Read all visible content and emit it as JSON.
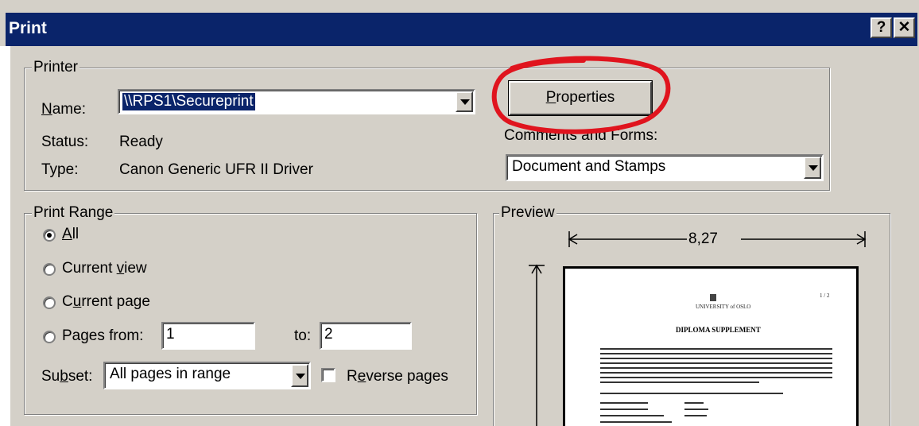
{
  "window": {
    "title": "Print",
    "help_label": "?",
    "close_label": "✕"
  },
  "printer": {
    "group_label": "Printer",
    "name_label_u": "N",
    "name_label_rest": "ame:",
    "name_value": "\\\\RPS1\\Secureprint",
    "status_label": "Status:",
    "status_value": "Ready",
    "type_label": "Type:",
    "type_value": "Canon Generic UFR II Driver",
    "properties_label_u": "P",
    "properties_label_rest": "roperties",
    "comments_label": "Comments and Forms:",
    "comments_value": "Document and Stamps"
  },
  "print_range": {
    "group_label": "Print Range",
    "options": [
      {
        "pre": "",
        "u": "A",
        "post": "ll",
        "checked": true
      },
      {
        "pre": "Current ",
        "u": "v",
        "post": "iew",
        "checked": false
      },
      {
        "pre": "C",
        "u": "u",
        "post": "rrent page",
        "checked": false
      },
      {
        "pre": "Pages from:",
        "u": "",
        "post": "",
        "checked": false
      }
    ],
    "from_value": "1",
    "to_label": "to:",
    "to_value": "2",
    "subset_label_pre": "Su",
    "subset_label_u": "b",
    "subset_label_post": "set:",
    "subset_value": "All pages in range",
    "reverse_label_pre": "R",
    "reverse_label_u": "e",
    "reverse_label_post": "verse pages"
  },
  "preview": {
    "group_label": "Preview",
    "width_value": "8,27",
    "doc_heading": "DIPLOMA SUPPLEMENT",
    "doc_header": "UNIVERSITY of OSLO",
    "page_no": "1 / 2"
  },
  "colors": {
    "titlebar": "#0a246a",
    "face": "#d4d0c8",
    "annotation": "#e0141e"
  }
}
